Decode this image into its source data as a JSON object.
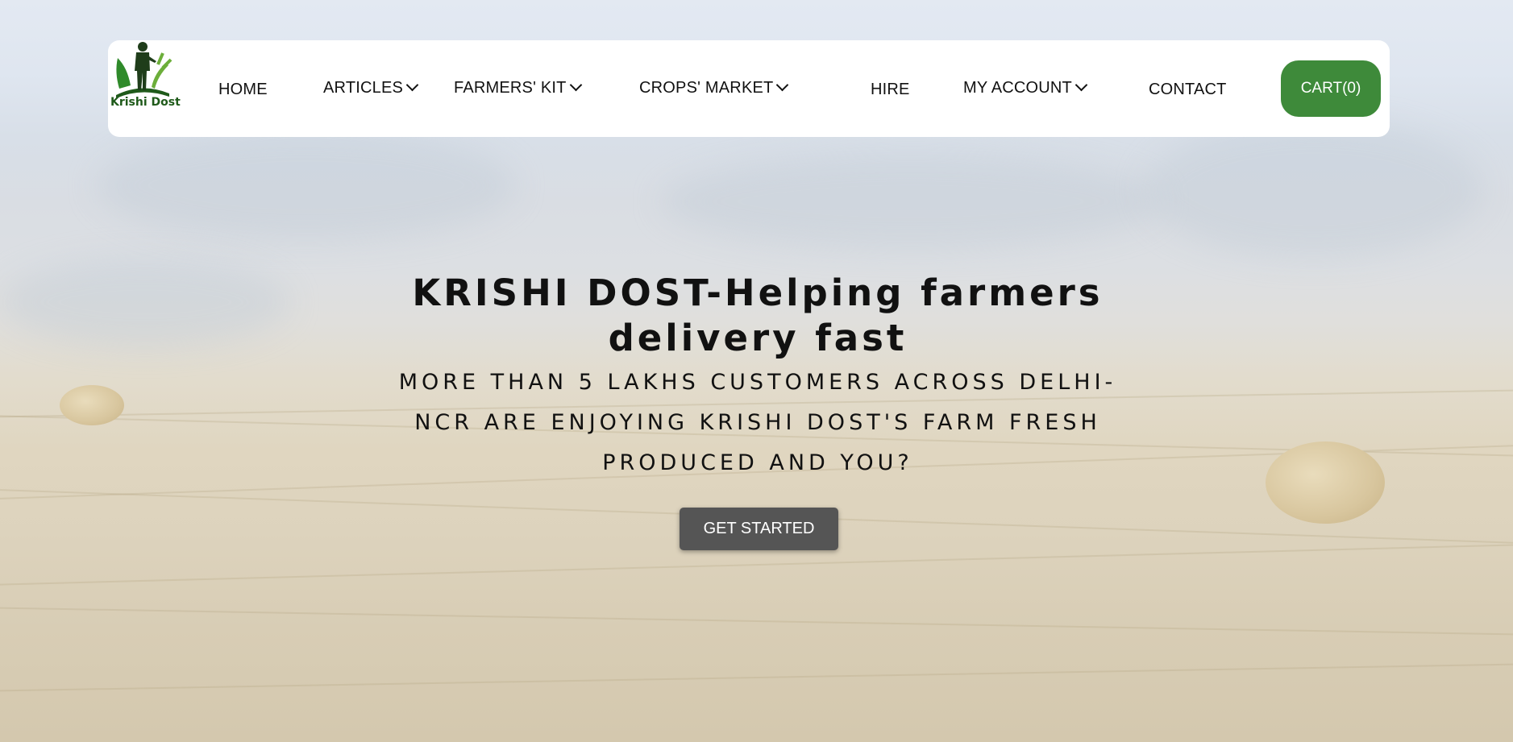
{
  "brand": {
    "logo_text": "Krishi Dost"
  },
  "nav": {
    "items": [
      {
        "label": "HOME"
      },
      {
        "label": "ARTICLES"
      },
      {
        "label": "FARMERS' KIT"
      },
      {
        "label": "CROPS' MARKET"
      },
      {
        "label": "HIRE"
      },
      {
        "label": "MY ACCOUNT"
      },
      {
        "label": "CONTACT"
      }
    ],
    "cart_label": "CART(0)"
  },
  "hero": {
    "title": "KRISHI DOST-Helping farmers delivery fast",
    "subtitle": "MORE THAN 5 LAKHS CUSTOMERS ACROSS DELHI-NCR ARE ENJOYING KRISHI DOST'S FARM FRESH PRODUCED AND YOU?",
    "cta_label": "GET STARTED"
  },
  "colors": {
    "accent": "#3e8a3a",
    "cta": "#555555",
    "logo_green": "#1f5a1a"
  },
  "icons": [
    "farmer-logo-icon",
    "chevron-down-icon"
  ]
}
